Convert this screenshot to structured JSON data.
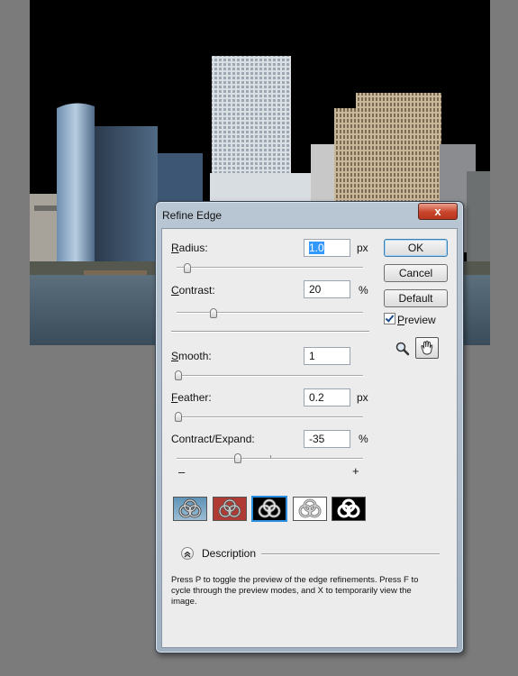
{
  "dialog": {
    "title": "Refine Edge",
    "close_glyph": "x"
  },
  "settings": {
    "radius": {
      "label_underlined": "R",
      "label_rest": "adius:",
      "value": "1.0",
      "unit": "px",
      "slider_fraction": 0.06
    },
    "contrast": {
      "label_underlined": "C",
      "label_rest": "ontrast:",
      "value": "20",
      "unit": "%",
      "slider_fraction": 0.2
    },
    "smooth": {
      "label_underlined": "S",
      "label_rest": "mooth:",
      "value": "1",
      "slider_fraction": 0.01
    },
    "feather": {
      "label_underlined": "F",
      "label_rest": "eather:",
      "value": "0.2",
      "unit": "px",
      "slider_fraction": 0.01
    },
    "contract_expand": {
      "label": "Contract/Expand:",
      "value": "-35",
      "unit": "%",
      "slider_fraction": 0.33,
      "min_symbol": "–",
      "max_symbol": "+"
    }
  },
  "buttons": {
    "ok": "OK",
    "cancel": "Cancel",
    "default": "Default"
  },
  "preview": {
    "checked": true,
    "label_underlined": "P",
    "label_rest": "review"
  },
  "tools": [
    "zoom-tool",
    "hand-tool"
  ],
  "preview_modes": [
    "Standard",
    "Quick Mask",
    "On Black",
    "On White",
    "Mask"
  ],
  "active_preview_mode": "On Black",
  "description": {
    "heading": "Description",
    "lines": [
      "Press P to toggle the preview of the edge refinements. Press F to",
      "cycle through the preview modes, and X to temporarily view the",
      "image."
    ]
  }
}
